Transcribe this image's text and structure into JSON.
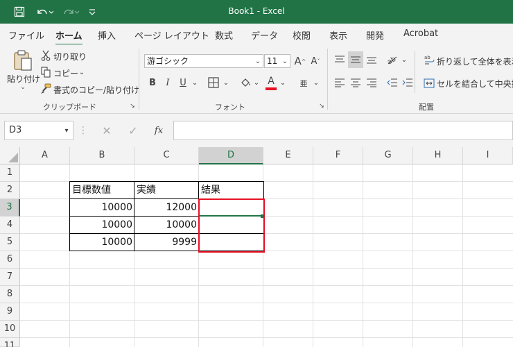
{
  "title_bar": {
    "title": "Book1  -  Excel",
    "save_icon": "save-icon",
    "undo_icon": "undo-icon",
    "redo_icon": "redo-icon",
    "customize_icon": "customize-quick-access-icon",
    "color": "#217346"
  },
  "menu": {
    "tabs": [
      "ファイル",
      "ホーム",
      "挿入",
      "ページ レイアウト",
      "数式",
      "データ",
      "校閲",
      "表示",
      "開発",
      "Acrobat"
    ],
    "active": "ホーム"
  },
  "ribbon": {
    "clipboard": {
      "paste": "貼り付け",
      "cut": "切り取り",
      "copy": "コピー",
      "format_painter": "書式のコピー/貼り付け",
      "label": "クリップボード"
    },
    "font": {
      "font_name": "游ゴシック",
      "font_size": "11",
      "bold": "B",
      "italic": "I",
      "underline": "U",
      "font_color_glyph": "A",
      "phonetic_glyph": "亜",
      "label": "フォント",
      "font_color_bar": "#e81123"
    },
    "alignment": {
      "wrap_text": "折り返して全体を表示す",
      "merge_center": "セルを結合して中央揃え",
      "label": "配置"
    }
  },
  "formula_bar": {
    "name_box": "D3",
    "fx": "fx",
    "formula": ""
  },
  "sheet": {
    "columns": [
      "A",
      "B",
      "C",
      "D",
      "E",
      "F",
      "G",
      "H",
      "I"
    ],
    "rows": [
      "1",
      "2",
      "3",
      "4",
      "5",
      "6",
      "7",
      "8",
      "9",
      "10",
      "11"
    ],
    "selected_column": "D",
    "selected_row": "3",
    "table": {
      "headers": [
        "目標数値",
        "実績",
        "結果"
      ],
      "rows": [
        [
          "10000",
          "12000",
          ""
        ],
        [
          "10000",
          "10000",
          ""
        ],
        [
          "10000",
          "9999",
          ""
        ]
      ]
    },
    "highlight_color": "#e81123"
  }
}
